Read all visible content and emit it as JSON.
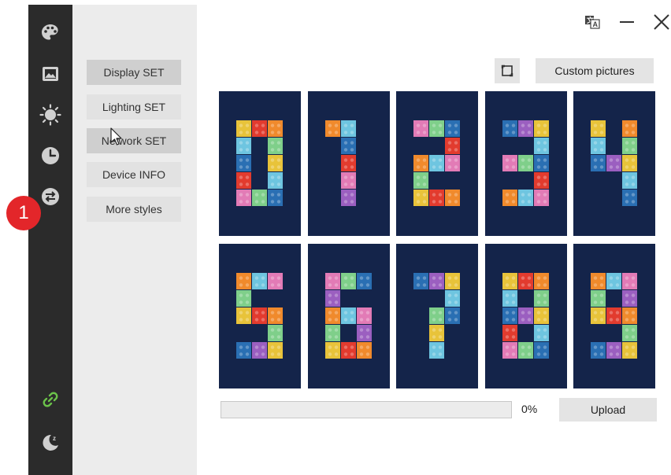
{
  "sidebar": {
    "icons": [
      "palette-icon",
      "image-icon",
      "sun-icon",
      "clock-icon",
      "swap-icon",
      "link-icon",
      "sleep-moon-icon"
    ],
    "badge": "1"
  },
  "menu": {
    "items": [
      {
        "label": "Display SET",
        "active": true
      },
      {
        "label": "Lighting SET",
        "active": false
      },
      {
        "label": "Network SET",
        "active": true
      },
      {
        "label": "Device INFO",
        "active": false
      },
      {
        "label": "More styles",
        "active": false
      }
    ]
  },
  "toolbar": {
    "custom_pictures": "Custom pictures",
    "crop_icon": "crop-square-icon"
  },
  "window": {
    "translate_icon": "translate-icon",
    "minimize_icon": "minimize-icon",
    "close_icon": "close-icon"
  },
  "tiles": [
    {
      "digit": "0"
    },
    {
      "digit": "1"
    },
    {
      "digit": "2"
    },
    {
      "digit": "3"
    },
    {
      "digit": "4"
    },
    {
      "digit": "5"
    },
    {
      "digit": "6"
    },
    {
      "digit": "7"
    },
    {
      "digit": "8"
    },
    {
      "digit": "9"
    }
  ],
  "upload": {
    "progress_percent": 0,
    "progress_label": "0%",
    "button": "Upload"
  },
  "colors": {
    "tile_bg": "#14244a",
    "rail": "#2b2b2b",
    "badge": "#e3262a",
    "link_icon": "#6bc24a"
  }
}
